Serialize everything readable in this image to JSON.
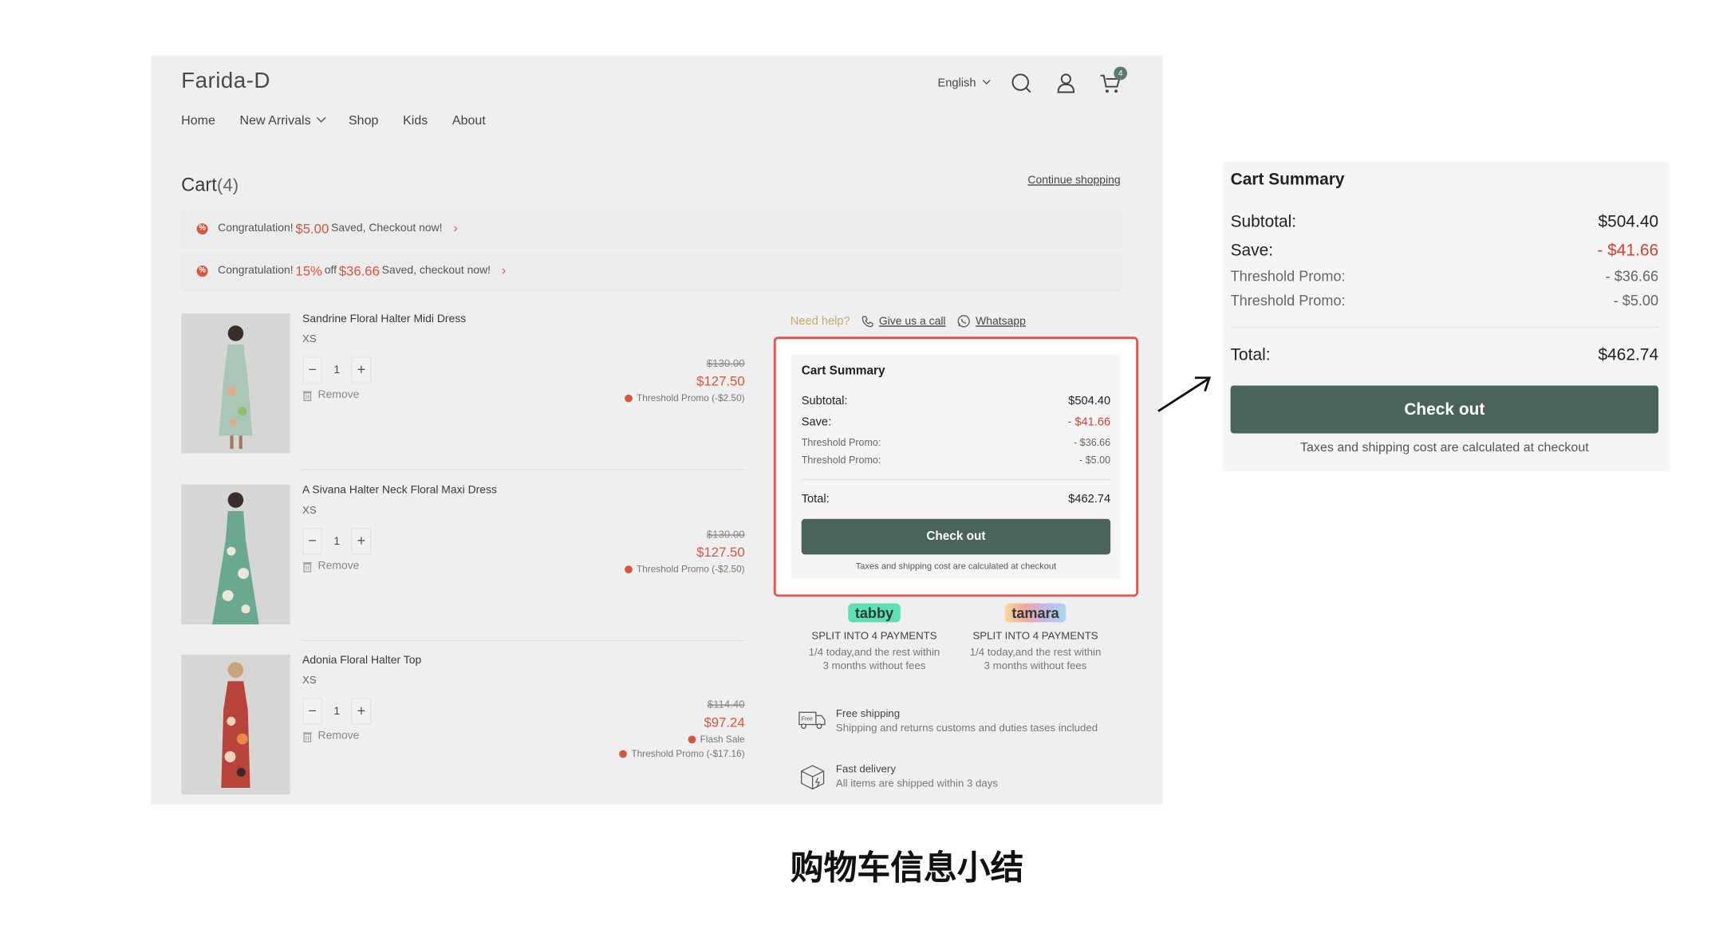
{
  "header": {
    "brand": "Farida-D",
    "nav": [
      "Home",
      "New Arrivals",
      "Shop",
      "Kids",
      "About"
    ],
    "language": "English",
    "cart_count": "4"
  },
  "cart": {
    "title": "Cart",
    "count_label": "(4)",
    "continue_label": "Continue shopping",
    "promos": [
      {
        "prefix": "Congratulation!",
        "highlight1": "$5.00",
        "highlight2": "",
        "mid": "",
        "suffix": "Saved, Checkout now!"
      },
      {
        "prefix": "Congratulation!",
        "highlight1": "15%",
        "mid": "off",
        "highlight2": "$36.66",
        "suffix": "Saved, checkout now!"
      }
    ],
    "remove_label": "Remove",
    "items": [
      {
        "name": "Sandrine Floral Halter Midi Dress",
        "size": "XS",
        "qty": "1",
        "old_price": "$130.00",
        "price": "$127.50",
        "tags": [
          "Threshold Promo (-$2.50)"
        ]
      },
      {
        "name": "A Sivana Halter Neck Floral Maxi Dress",
        "size": "XS",
        "qty": "1",
        "old_price": "$130.00",
        "price": "$127.50",
        "tags": [
          "Threshold Promo (-$2.50)"
        ]
      },
      {
        "name": "Adonia Floral Halter Top",
        "size": "XS",
        "qty": "1",
        "old_price": "$114.40",
        "price": "$97.24",
        "tags": [
          "Flash Sale",
          "Threshold Promo (-$17.16)"
        ]
      }
    ]
  },
  "help": {
    "label": "Need help?",
    "call": "Give us a call",
    "whatsapp": "Whatsapp"
  },
  "summary": {
    "title": "Cart Summary",
    "subtotal_label": "Subtotal:",
    "subtotal": "$504.40",
    "save_label": "Save:",
    "save": "- $41.66",
    "promo1_label": "Threshold Promo:",
    "promo1": "- $36.66",
    "promo2_label": "Threshold Promo:",
    "promo2": "- $5.00",
    "total_label": "Total:",
    "total": "$462.74",
    "checkout_label": "Check out",
    "note": "Taxes and shipping cost are calculated at checkout"
  },
  "payments": [
    {
      "logo": "tabby",
      "head": "SPLIT INTO 4 PAYMENTS",
      "desc1": "1/4 today,and the rest within",
      "desc2": "3 months without fees"
    },
    {
      "logo": "tamara",
      "head": "SPLIT INTO 4 PAYMENTS",
      "desc1": "1/4 today,and the rest within",
      "desc2": "3 months without fees"
    }
  ],
  "features": [
    {
      "title": "Free shipping",
      "desc": "Shipping and returns customs and duties tases included",
      "icon_text": "Free"
    },
    {
      "title": "Fast delivery",
      "desc": "All items are shipped within 3 days"
    }
  ],
  "caption": "购物车信息小结",
  "colors": {
    "accent_red": "#d9563d",
    "button_green": "#4a6459",
    "highlight_border": "#e5534b",
    "help_gold": "#c9a86a"
  }
}
